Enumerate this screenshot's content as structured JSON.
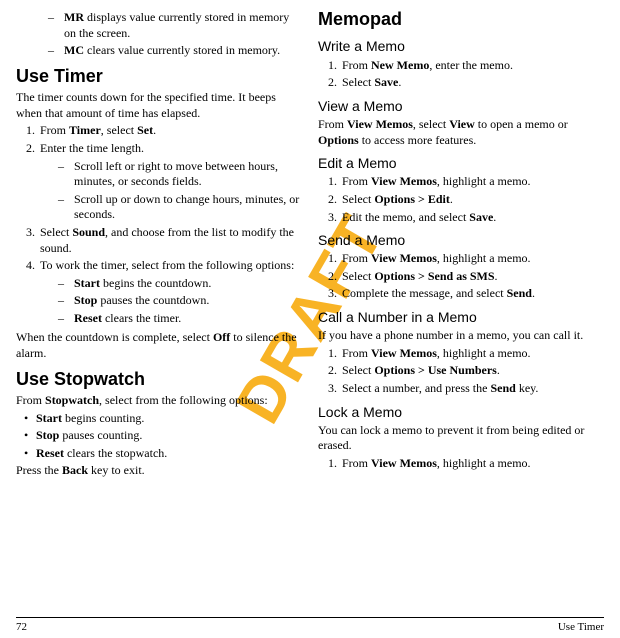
{
  "watermark": "DRAFT",
  "footer": {
    "page_number": "72",
    "section": "Use Timer"
  },
  "left": {
    "mr_mc_sub": [
      {
        "bold": "MR",
        "rest": " displays value currently stored in memory on the screen."
      },
      {
        "bold": "MC",
        "rest": " clears value currently stored in memory."
      }
    ],
    "use_timer": {
      "heading": "Use Timer",
      "intro": "The timer counts down for the specified time. It beeps when that amount of time has elapsed.",
      "step1_pre": "From ",
      "step1_bold1": "Timer",
      "step1_mid": ", select ",
      "step1_bold2": "Set",
      "step1_post": ".",
      "step2": "Enter the time length.",
      "step2_sub": [
        "Scroll left or right to move between hours, minutes, or seconds fields.",
        "Scroll up or down to change hours, minutes, or seconds."
      ],
      "step3_pre": "Select ",
      "step3_bold": "Sound",
      "step3_post": ", and choose from the list to modify the sound.",
      "step4": "To work the timer, select from the following options:",
      "step4_sub": [
        {
          "bold": "Start",
          "rest": " begins the countdown."
        },
        {
          "bold": "Stop",
          "rest": " pauses the countdown."
        },
        {
          "bold": "Reset",
          "rest": " clears the timer."
        }
      ],
      "outro_pre": "When the countdown is complete, select ",
      "outro_bold": "Off",
      "outro_post": " to silence the alarm."
    },
    "use_stopwatch": {
      "heading": "Use Stopwatch",
      "intro_pre": "From ",
      "intro_bold": "Stopwatch",
      "intro_post": ", select from the following options:",
      "bullets": [
        {
          "bold": "Start",
          "rest": " begins counting."
        },
        {
          "bold": "Stop",
          "rest": " pauses counting."
        },
        {
          "bold": "Reset",
          "rest": " clears the stopwatch."
        }
      ],
      "outro_pre": "Press the ",
      "outro_bold": "Back",
      "outro_post": " key to exit."
    }
  },
  "right": {
    "memopad_heading": "Memopad",
    "write": {
      "heading": "Write a Memo",
      "s1_pre": "From ",
      "s1_bold": "New Memo",
      "s1_post": ", enter the memo.",
      "s2_pre": "Select ",
      "s2_bold": "Save",
      "s2_post": "."
    },
    "view": {
      "heading": "View a Memo",
      "p_pre": "From ",
      "p_b1": "View Memos",
      "p_mid1": ", select ",
      "p_b2": "View",
      "p_mid2": " to open a memo or ",
      "p_b3": "Options",
      "p_post": " to access more features."
    },
    "edit": {
      "heading": "Edit a Memo",
      "s1_pre": "From ",
      "s1_bold": "View Memos",
      "s1_post": ", highlight a memo.",
      "s2_pre": "Select ",
      "s2_bold": "Options > Edit",
      "s2_post": ".",
      "s3_pre": "Edit the memo, and select ",
      "s3_bold": "Save",
      "s3_post": "."
    },
    "send": {
      "heading": "Send a Memo",
      "s1_pre": "From ",
      "s1_bold": "View Memos",
      "s1_post": ", highlight a memo.",
      "s2_pre": "Select ",
      "s2_bold": "Options > Send as SMS",
      "s2_post": ".",
      "s3_pre": "Complete the message, and select ",
      "s3_bold": "Send",
      "s3_post": "."
    },
    "call": {
      "heading": "Call a Number in a Memo",
      "intro": "If you have a phone number in a memo, you can call it.",
      "s1_pre": "From ",
      "s1_bold": "View Memos",
      "s1_post": ", highlight a memo.",
      "s2_pre": "Select ",
      "s2_bold": "Options > Use Numbers",
      "s2_post": ".",
      "s3_pre": "Select a number, and press the ",
      "s3_bold": "Send",
      "s3_post": " key."
    },
    "lock": {
      "heading": "Lock a Memo",
      "intro": "You can lock a memo to prevent it from being edited or erased.",
      "s1_pre": "From ",
      "s1_bold": "View Memos",
      "s1_post": ", highlight a memo."
    }
  }
}
